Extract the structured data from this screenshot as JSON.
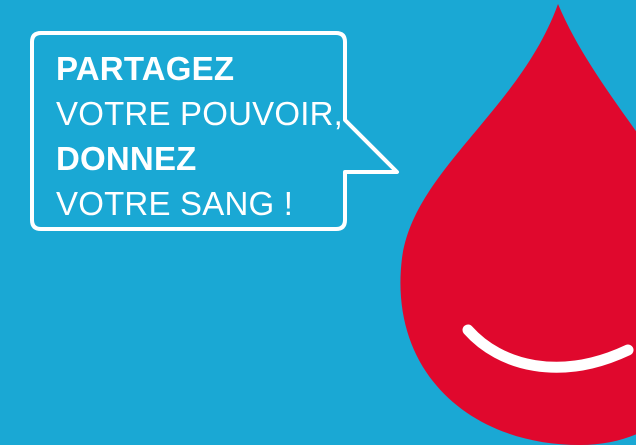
{
  "colors": {
    "background": "#1aa8d4",
    "drop": "#e0082d",
    "text": "#ffffff"
  },
  "message": {
    "line1": "PARTAGEZ",
    "line2": "VOTRE POUVOIR,",
    "line3": "DONNEZ",
    "line4": "VOTRE SANG !"
  },
  "icons": {
    "drop": "blood-drop-icon",
    "smile": "smile-icon",
    "bubble": "speech-bubble-icon"
  }
}
